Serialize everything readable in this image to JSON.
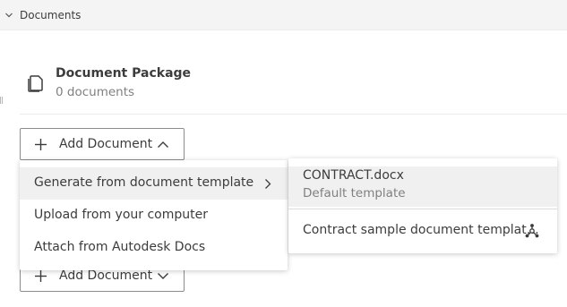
{
  "section": {
    "title": "Documents"
  },
  "package": {
    "name": "Document Package",
    "count_text": "0 documents"
  },
  "add_button": {
    "label": "Add Document"
  },
  "menu": {
    "items": [
      {
        "label": "Generate from document template",
        "has_submenu": true,
        "active": true
      },
      {
        "label": "Upload from your computer"
      },
      {
        "label": "Attach from Autodesk Docs"
      }
    ]
  },
  "submenu": {
    "items": [
      {
        "name": "CONTRACT.docx",
        "description": "Default template",
        "active": true
      },
      {
        "name": "Contract sample document templat…",
        "icon": "share-icon"
      }
    ]
  }
}
